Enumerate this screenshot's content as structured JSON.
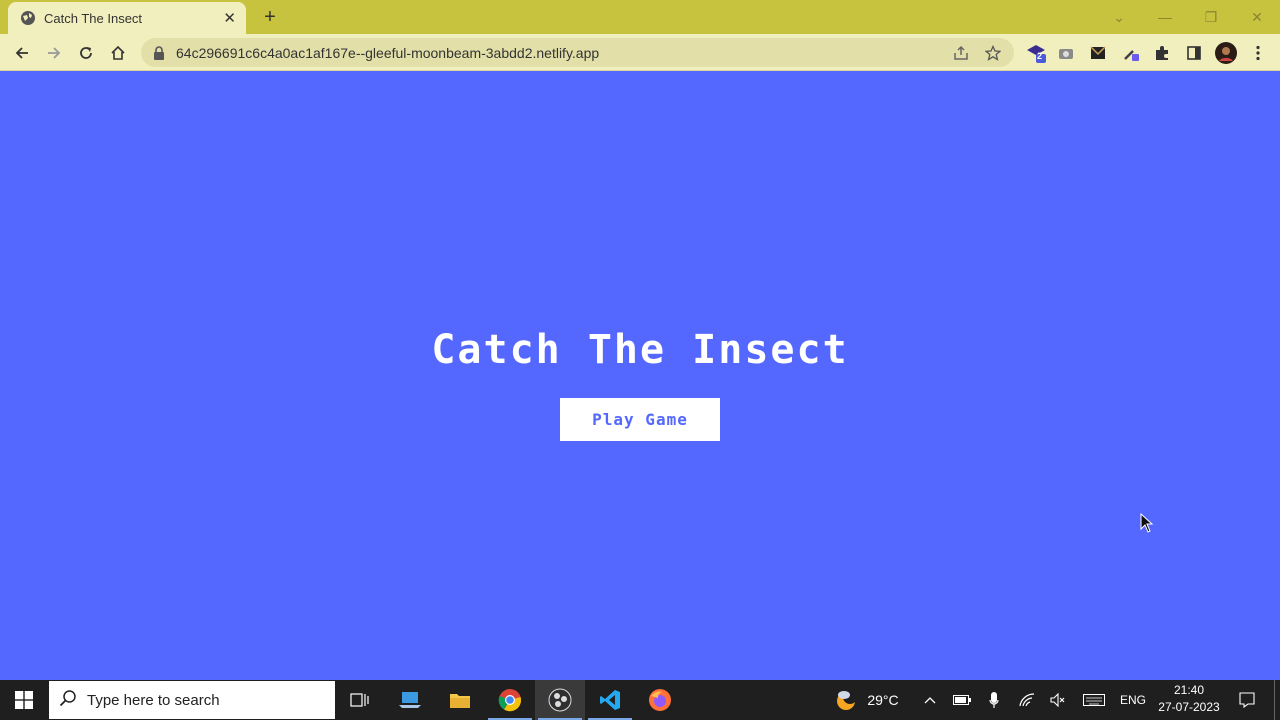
{
  "browser": {
    "tab": {
      "title": "Catch The Insect",
      "close": "✕"
    },
    "new_tab": "+",
    "url": "64c296691c6c4a0ac1af167e--gleeful-moonbeam-3abdd2.netlify.app",
    "extension_badge": "2"
  },
  "page": {
    "title": "Catch The Insect",
    "play_button": "Play Game",
    "background_color": "#5468ff"
  },
  "taskbar": {
    "search_placeholder": "Type here to search",
    "weather_temp": "29°C",
    "language": "ENG",
    "time": "21:40",
    "date": "27-07-2023"
  }
}
